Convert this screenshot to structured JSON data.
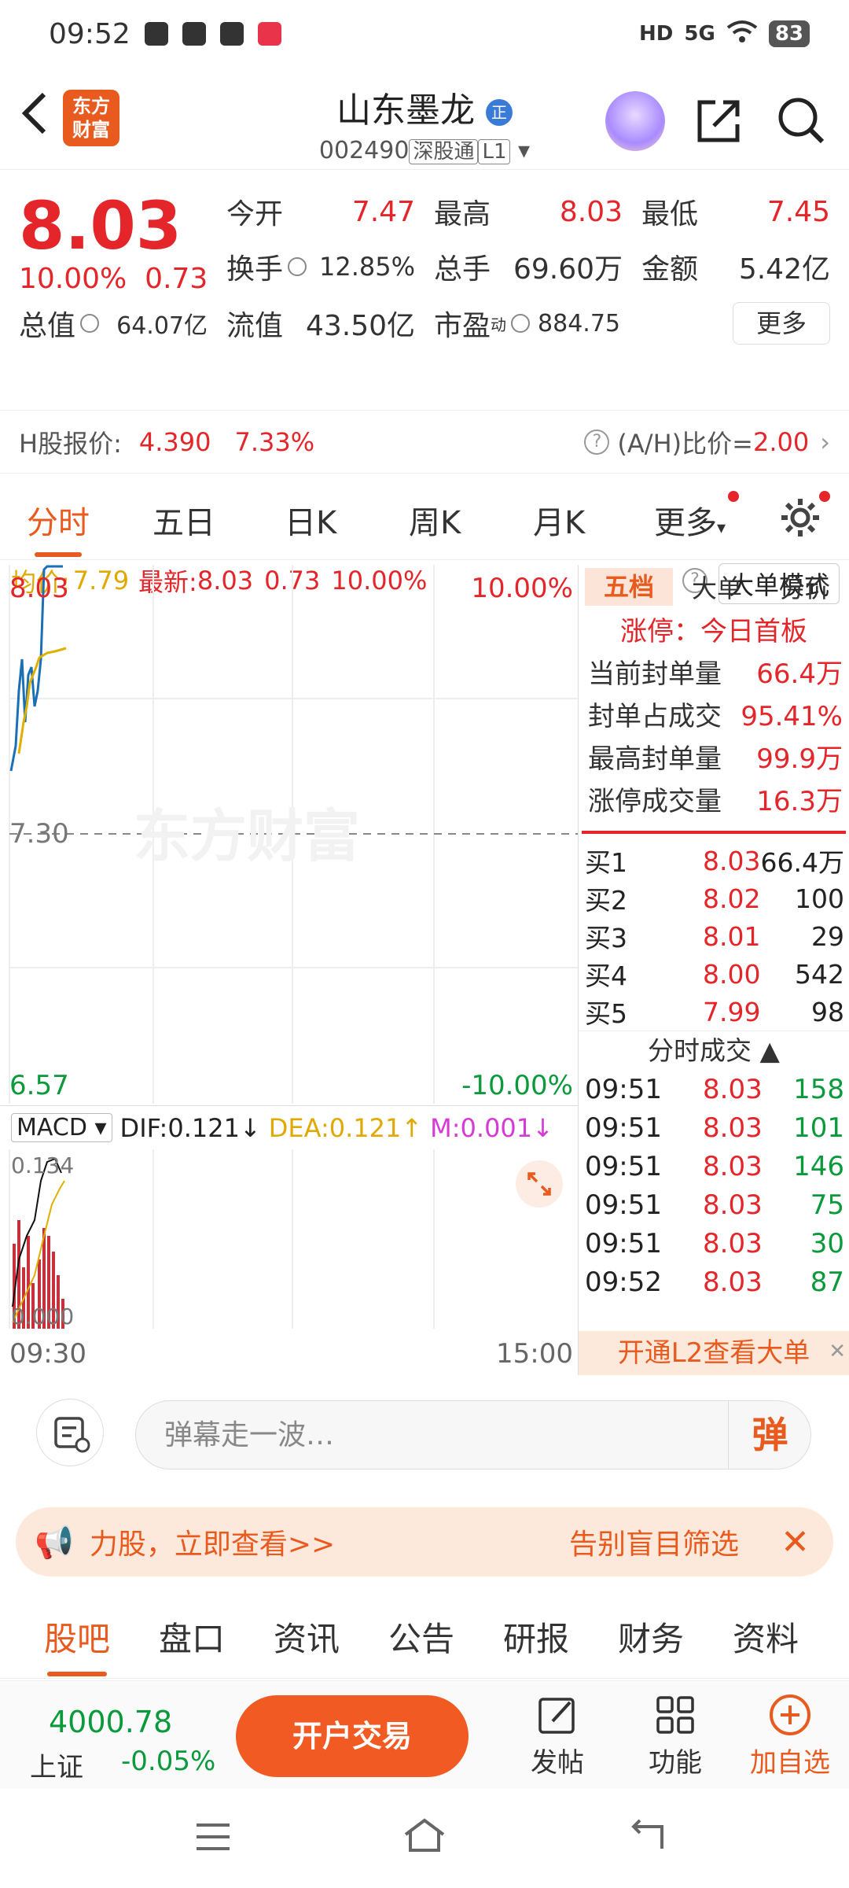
{
  "status": {
    "time": "09:52",
    "network": "5G",
    "hd": "HD",
    "battery": "83"
  },
  "header": {
    "logo_line1": "东方",
    "logo_line2": "财富",
    "stock_name": "山东墨龙",
    "zheng_badge": "正",
    "code": "002490",
    "market_tag": "深股通",
    "level": "L1"
  },
  "quote": {
    "price": "8.03",
    "pct": "10.00%",
    "chg": "0.73",
    "open_label": "今开",
    "open": "7.47",
    "high_label": "最高",
    "high": "8.03",
    "low_label": "最低",
    "low": "7.45",
    "turnover_label": "换手",
    "turnover": "12.85%",
    "volume_label": "总手",
    "volume": "69.60万",
    "amount_label": "金额",
    "amount": "5.42亿",
    "mktcap_label": "总值",
    "mktcap": "64.07亿",
    "float_label": "流值",
    "float": "43.50亿",
    "pe_label": "市盈",
    "pe_sup": "动",
    "pe": "884.75",
    "more": "更多"
  },
  "hshare": {
    "label": "H股报价:",
    "price": "4.390",
    "pct": "7.33%",
    "ah_label": "(A/H)比价=",
    "ah_value": "2.00"
  },
  "tabs": [
    "分时",
    "五日",
    "日K",
    "周K",
    "月K",
    "更多"
  ],
  "avg": {
    "avg_label": "均价:",
    "avg": "7.79",
    "latest_label": "最新:",
    "latest": "8.03",
    "chg": "0.73",
    "pct": "10.00%",
    "bigmode": "大单模式"
  },
  "chart": {
    "top_price": "8.03",
    "top_pct": "10.00%",
    "mid_price": "7.30",
    "bottom_price": "6.57",
    "bottom_pct": "-10.00%",
    "watermark": "东方财富",
    "time_start": "09:30",
    "time_end": "15:00"
  },
  "macd": {
    "name": "MACD",
    "dif": "DIF:0.121",
    "dea": "DEA:0.121",
    "m": "M:0.001",
    "top": "0.134",
    "zero": "0.000"
  },
  "panel": {
    "tabs": [
      "五档",
      "大单",
      "分价"
    ],
    "limit_title": "涨停：今日首板",
    "limit_rows": [
      {
        "k": "当前封单量",
        "v": "66.4万"
      },
      {
        "k": "封单占成交",
        "v": "95.41%"
      },
      {
        "k": "最高封单量",
        "v": "99.9万"
      },
      {
        "k": "涨停成交量",
        "v": "16.3万"
      }
    ],
    "book": [
      {
        "label": "买1",
        "price": "8.03",
        "qty": "66.4万"
      },
      {
        "label": "买2",
        "price": "8.02",
        "qty": "100"
      },
      {
        "label": "买3",
        "price": "8.01",
        "qty": "29"
      },
      {
        "label": "买4",
        "price": "8.00",
        "qty": "542"
      },
      {
        "label": "买5",
        "price": "7.99",
        "qty": "98"
      }
    ],
    "trades_title": "分时成交",
    "trades": [
      {
        "time": "09:51",
        "price": "8.03",
        "qty": "158"
      },
      {
        "time": "09:51",
        "price": "8.03",
        "qty": "101"
      },
      {
        "time": "09:51",
        "price": "8.03",
        "qty": "146"
      },
      {
        "time": "09:51",
        "price": "8.03",
        "qty": "75"
      },
      {
        "time": "09:51",
        "price": "8.03",
        "qty": "30"
      },
      {
        "time": "09:52",
        "price": "8.03",
        "qty": "87"
      }
    ],
    "l2": "开通L2查看大单"
  },
  "danmu": {
    "placeholder": "弹幕走一波…",
    "btn": "弹"
  },
  "promo": {
    "left": "力股，立即查看>>",
    "right": "告别盲目筛选"
  },
  "bottom_tabs": [
    "股吧",
    "盘口",
    "资讯",
    "公告",
    "研报",
    "财务",
    "资料"
  ],
  "footer": {
    "index_value": "4000.78",
    "index_name": "上证",
    "index_chg": "-0.05%",
    "open_btn": "开户交易",
    "post": "发帖",
    "func": "功能",
    "add": "加自选"
  },
  "colors": {
    "up": "#e4262b",
    "down": "#0a9a3c",
    "accent": "#e85a1d"
  }
}
